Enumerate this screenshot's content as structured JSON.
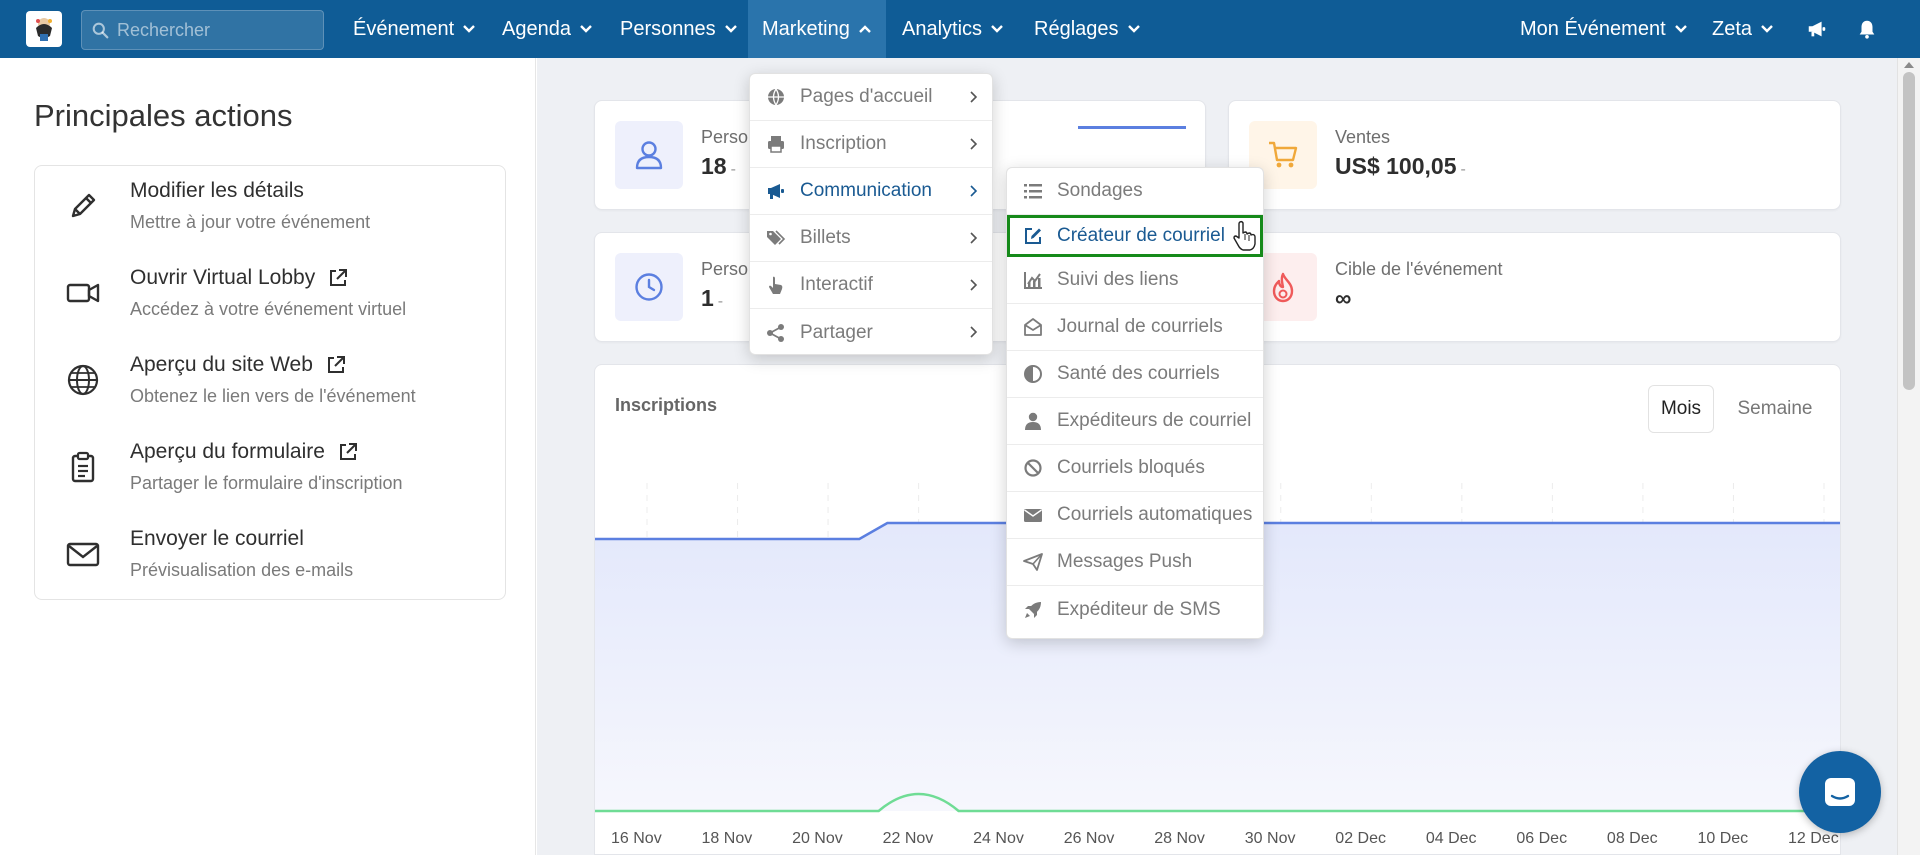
{
  "nav": {
    "search_placeholder": "Rechercher",
    "items": [
      "Événement",
      "Agenda",
      "Personnes",
      "Marketing",
      "Analytics",
      "Réglages"
    ],
    "active_item": "Marketing",
    "event_selector": "Mon Événement",
    "user_name": "Zeta"
  },
  "left": {
    "title": "Principales actions",
    "actions": [
      {
        "title": "Modifier les détails",
        "subtitle": "Mettre à jour votre événement",
        "icon": "pencil-icon",
        "external": false
      },
      {
        "title": "Ouvrir Virtual Lobby",
        "subtitle": "Accédez à votre événement virtuel",
        "icon": "video-camera-icon",
        "external": true
      },
      {
        "title": "Aperçu du site Web",
        "subtitle": "Obtenez le lien vers de l'événement",
        "icon": "globe-icon",
        "external": true
      },
      {
        "title": "Aperçu du formulaire",
        "subtitle": "Partager le formulaire d'inscription",
        "icon": "clipboard-icon",
        "external": true
      },
      {
        "title": "Envoyer le courriel",
        "subtitle": "Prévisualisation des e-mails",
        "icon": "envelope-icon",
        "external": false
      }
    ]
  },
  "stats": [
    {
      "label": "Perso",
      "value": "18",
      "suffix": "-",
      "icon": "user-icon"
    },
    {
      "label": "Ventes",
      "value": "US$ 100,05",
      "suffix": "-",
      "icon": "cart-icon"
    },
    {
      "label": "Perso",
      "value": "1",
      "suffix": "-",
      "icon": "clock-icon"
    },
    {
      "label": "Cible de l'événement",
      "value": "∞",
      "suffix": "",
      "icon": "fire-icon"
    }
  ],
  "chart": {
    "title": "Inscriptions",
    "toggle_on": "Mois",
    "toggle_off": "Semaine"
  },
  "chart_data": {
    "type": "area",
    "title": "Inscriptions",
    "categories": [
      "16 Nov",
      "18 Nov",
      "20 Nov",
      "22 Nov",
      "24 Nov",
      "26 Nov",
      "28 Nov",
      "30 Nov",
      "02 Dec",
      "04 Dec",
      "06 Dec",
      "08 Dec",
      "10 Dec",
      "12 Dec"
    ],
    "series": [
      {
        "values": [
          17,
          17,
          17,
          18,
          18,
          18,
          18,
          18,
          18,
          18,
          18,
          18,
          18,
          18
        ],
        "color": "#5b7fe0"
      },
      {
        "values": [
          0,
          0,
          0,
          1,
          0,
          0,
          0,
          0,
          0,
          0,
          0,
          0,
          0,
          0
        ],
        "color": "#6fdc95"
      }
    ],
    "grid": "vertical-dashed"
  },
  "marketing_menu": {
    "items": [
      {
        "label": "Pages d'accueil",
        "icon": "globe-icon"
      },
      {
        "label": "Inscription",
        "icon": "printer-icon"
      },
      {
        "label": "Communication",
        "icon": "megaphone-icon"
      },
      {
        "label": "Billets",
        "icon": "tags-icon"
      },
      {
        "label": "Interactif",
        "icon": "pointer-hand-icon"
      },
      {
        "label": "Partager",
        "icon": "share-icon"
      }
    ],
    "active": "Communication"
  },
  "communication_menu": {
    "items": [
      {
        "label": "Sondages",
        "icon": "list-icon"
      },
      {
        "label": "Créateur de courriel",
        "icon": "edit-icon"
      },
      {
        "label": "Suivi des liens",
        "icon": "chart-line-icon"
      },
      {
        "label": "Journal de courriels",
        "icon": "envelope-open-icon"
      },
      {
        "label": "Santé des courriels",
        "icon": "half-circle-icon"
      },
      {
        "label": "Expéditeurs de courriel",
        "icon": "user-icon"
      },
      {
        "label": "Courriels bloqués",
        "icon": "ban-icon"
      },
      {
        "label": "Courriels automatiques",
        "icon": "envelope-icon"
      },
      {
        "label": "Messages Push",
        "icon": "paper-plane-icon"
      },
      {
        "label": "Expéditeur de SMS",
        "icon": "rocket-icon"
      }
    ],
    "highlighted": "Créateur de courriel"
  },
  "colors": {
    "nav_bg": "#0f5c96",
    "nav_active": "#2a74ac",
    "highlight_border": "#168a1a",
    "link_blue": "#1a5a92"
  }
}
